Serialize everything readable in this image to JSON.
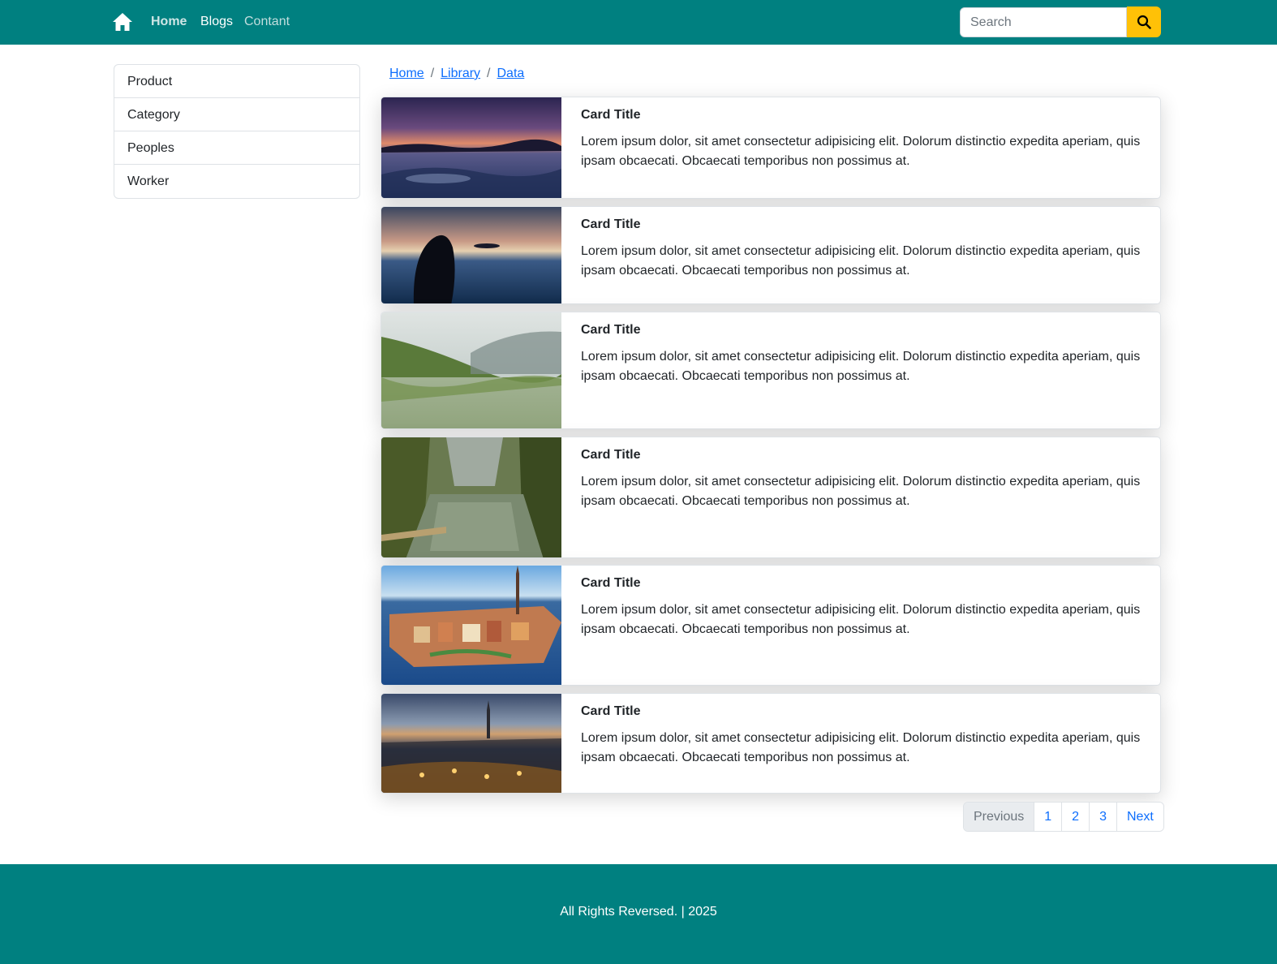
{
  "navbar": {
    "home_icon": "home-icon",
    "links": [
      "Home",
      "Blogs",
      "Contant"
    ],
    "search": {
      "placeholder": "Search",
      "value": "",
      "button_icon": "search-icon"
    },
    "colors": {
      "background": "#008080",
      "search_button": "#ffc107"
    }
  },
  "sidebar": {
    "items": [
      {
        "label": "Product"
      },
      {
        "label": "Category"
      },
      {
        "label": "Peoples"
      },
      {
        "label": "Worker"
      }
    ]
  },
  "breadcrumb": {
    "items": [
      "Home",
      "Library",
      "Data"
    ],
    "separator": "/"
  },
  "cards": [
    {
      "title": "Card Title",
      "text": "Lorem ipsum dolor, sit amet consectetur adipisicing elit. Dolorum distinctio expedita aperiam, quis ipsam obcaecati. Obcaecati temporibus non possimus at.",
      "image": "sunset-coast-photo"
    },
    {
      "title": "Card Title",
      "text": "Lorem ipsum dolor, sit amet consectetur adipisicing elit. Dolorum distinctio expedita aperiam, quis ipsam obcaecati. Obcaecati temporibus non possimus at.",
      "image": "woman-in-sea-photo"
    },
    {
      "title": "Card Title",
      "text": "Lorem ipsum dolor, sit amet consectetur adipisicing elit. Dolorum distinctio expedita aperiam, quis ipsam obcaecati. Obcaecati temporibus non possimus at.",
      "image": "mountain-lake-photo"
    },
    {
      "title": "Card Title",
      "text": "Lorem ipsum dolor, sit amet consectetur adipisicing elit. Dolorum distinctio expedita aperiam, quis ipsam obcaecati. Obcaecati temporibus non possimus at.",
      "image": "forest-river-photo"
    },
    {
      "title": "Card Title",
      "text": "Lorem ipsum dolor, sit amet consectetur adipisicing elit. Dolorum distinctio expedita aperiam, quis ipsam obcaecati. Obcaecati temporibus non possimus at.",
      "image": "city-island-photo"
    },
    {
      "title": "Card Title",
      "text": "Lorem ipsum dolor, sit amet consectetur adipisicing elit. Dolorum distinctio expedita aperiam, quis ipsam obcaecati. Obcaecati temporibus non possimus at.",
      "image": "city-night-photo"
    }
  ],
  "pagination": {
    "previous": "Previous",
    "pages": [
      "1",
      "2",
      "3"
    ],
    "next": "Next"
  },
  "footer": {
    "text": "All Rights Reversed. | 2025"
  }
}
